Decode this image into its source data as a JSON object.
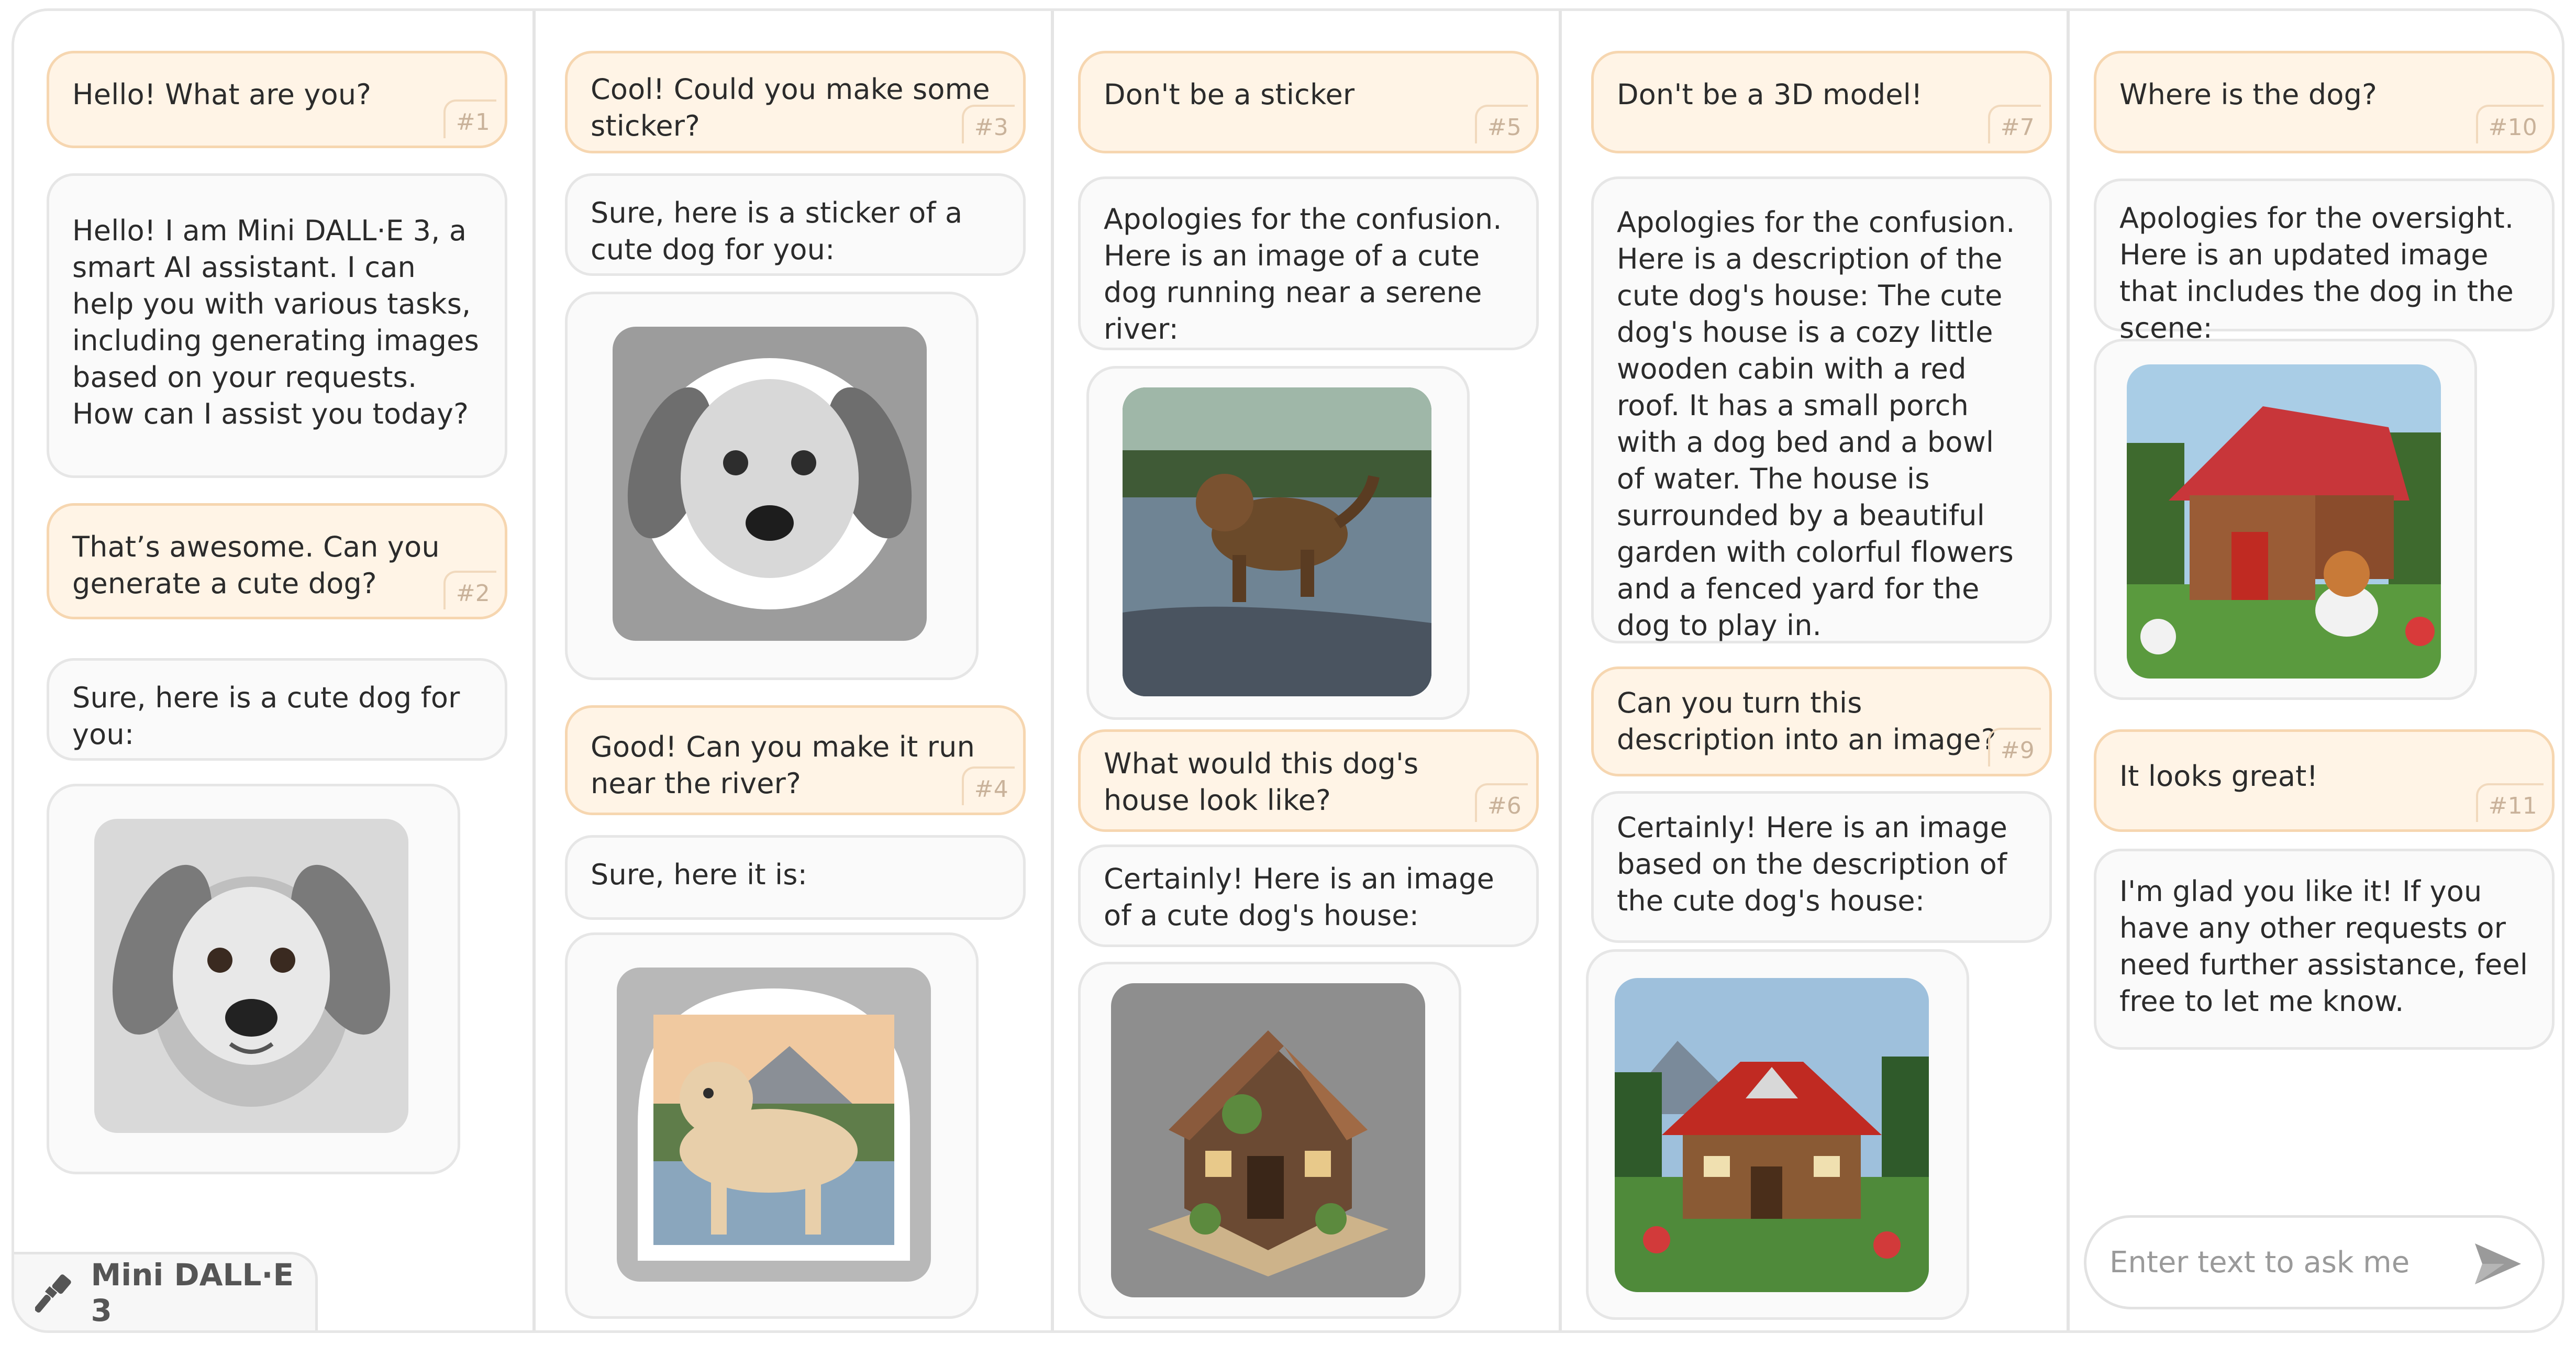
{
  "app": {
    "name": "Mini DALL·E 3",
    "logo_icon": "paintbrush-icon",
    "accent_user_bg": "#fff4e6",
    "accent_user_border": "#f6d6b0"
  },
  "composer": {
    "placeholder": "Enter text to ask me",
    "send_icon": "send-arrow-icon"
  },
  "columns": [
    {
      "messages": [
        {
          "role": "user",
          "text": "Hello! What are you?",
          "num": "#1"
        },
        {
          "role": "assistant",
          "text": "Hello! I am Mini DALL·E 3, a smart AI assistant. I can help you with various tasks, including generating images based on your requests. How can I assist you today?"
        },
        {
          "role": "user",
          "text": "That’s awesome. Can you generate a cute dog?",
          "num": "#2"
        },
        {
          "role": "assistant",
          "text": "Sure, here is a cute dog for you:"
        },
        {
          "role": "assistant",
          "image": "pencil-sketch-puppy-image"
        }
      ]
    },
    {
      "messages": [
        {
          "role": "user",
          "text": "Cool! Could you make some sticker?",
          "num": "#3"
        },
        {
          "role": "assistant",
          "text": "Sure, here is a sticker of a cute dog for you:"
        },
        {
          "role": "assistant",
          "image": "puppy-sticker-image"
        },
        {
          "role": "user",
          "text": "Good! Can you make it run near the river?",
          "num": "#4"
        },
        {
          "role": "assistant",
          "text": "Sure, here it is:"
        },
        {
          "role": "assistant",
          "image": "running-dog-sticker-image"
        }
      ]
    },
    {
      "messages": [
        {
          "role": "user",
          "text": "Don't be a sticker",
          "num": "#5"
        },
        {
          "role": "assistant",
          "text": "Apologies for the confusion. Here is an image of a cute dog running near a serene river:"
        },
        {
          "role": "assistant",
          "image": "dog-running-river-image"
        },
        {
          "role": "user",
          "text": "What would this dog's house look like?",
          "num": "#6"
        },
        {
          "role": "assistant",
          "text": "Certainly! Here is an image of a cute dog's house:"
        },
        {
          "role": "assistant",
          "image": "3d-dog-house-image"
        }
      ]
    },
    {
      "messages": [
        {
          "role": "user",
          "text": "Don't be a 3D model!",
          "num": "#7"
        },
        {
          "role": "assistant",
          "text": "Apologies for the confusion. Here is a description of the cute dog's house: The cute dog's house is a cozy little wooden cabin with a red roof. It has a small porch with a dog bed and a bowl of water. The house is surrounded by a beautiful garden with colorful flowers and a fenced yard for the dog to play in."
        },
        {
          "role": "user",
          "text": "Can you turn this description into an image?",
          "num": "#9"
        },
        {
          "role": "assistant",
          "text": "Certainly! Here is an image based on the description of the cute dog's house:"
        },
        {
          "role": "assistant",
          "image": "red-roof-cabin-image"
        }
      ]
    },
    {
      "messages": [
        {
          "role": "user",
          "text": "Where is the dog?",
          "num": "#10"
        },
        {
          "role": "assistant",
          "text": "Apologies for the oversight. Here is an updated image that includes the dog in the scene:"
        },
        {
          "role": "assistant",
          "image": "cabin-with-dog-image"
        },
        {
          "role": "user",
          "text": "It looks great!",
          "num": "#11"
        },
        {
          "role": "assistant",
          "text": "I'm glad you like it! If you have any other requests or need further assistance, feel free to let me know."
        }
      ]
    }
  ]
}
